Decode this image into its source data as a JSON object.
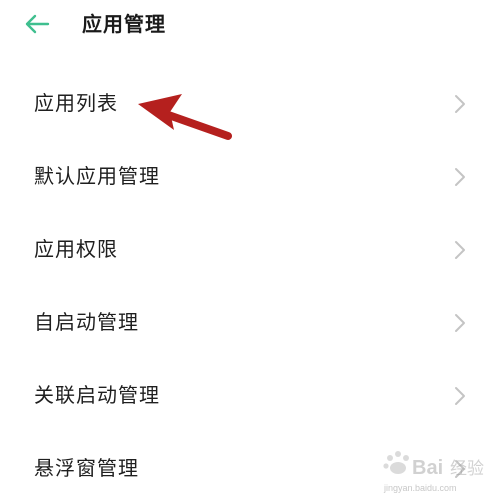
{
  "header": {
    "title": "应用管理",
    "back_icon": "arrow-left-icon",
    "accent_color": "#3fbf8f"
  },
  "list": {
    "items": [
      {
        "label": "应用列表"
      },
      {
        "label": "默认应用管理"
      },
      {
        "label": "应用权限"
      },
      {
        "label": "自启动管理"
      },
      {
        "label": "关联启动管理"
      },
      {
        "label": "悬浮窗管理"
      }
    ],
    "chevron_icon": "chevron-right-icon",
    "chevron_color": "#c4c4c4"
  },
  "annotation": {
    "arrow_color": "#b5201e"
  },
  "watermark": {
    "text": "Baidu 经验",
    "subtext": "jingyan.baidu.com"
  }
}
